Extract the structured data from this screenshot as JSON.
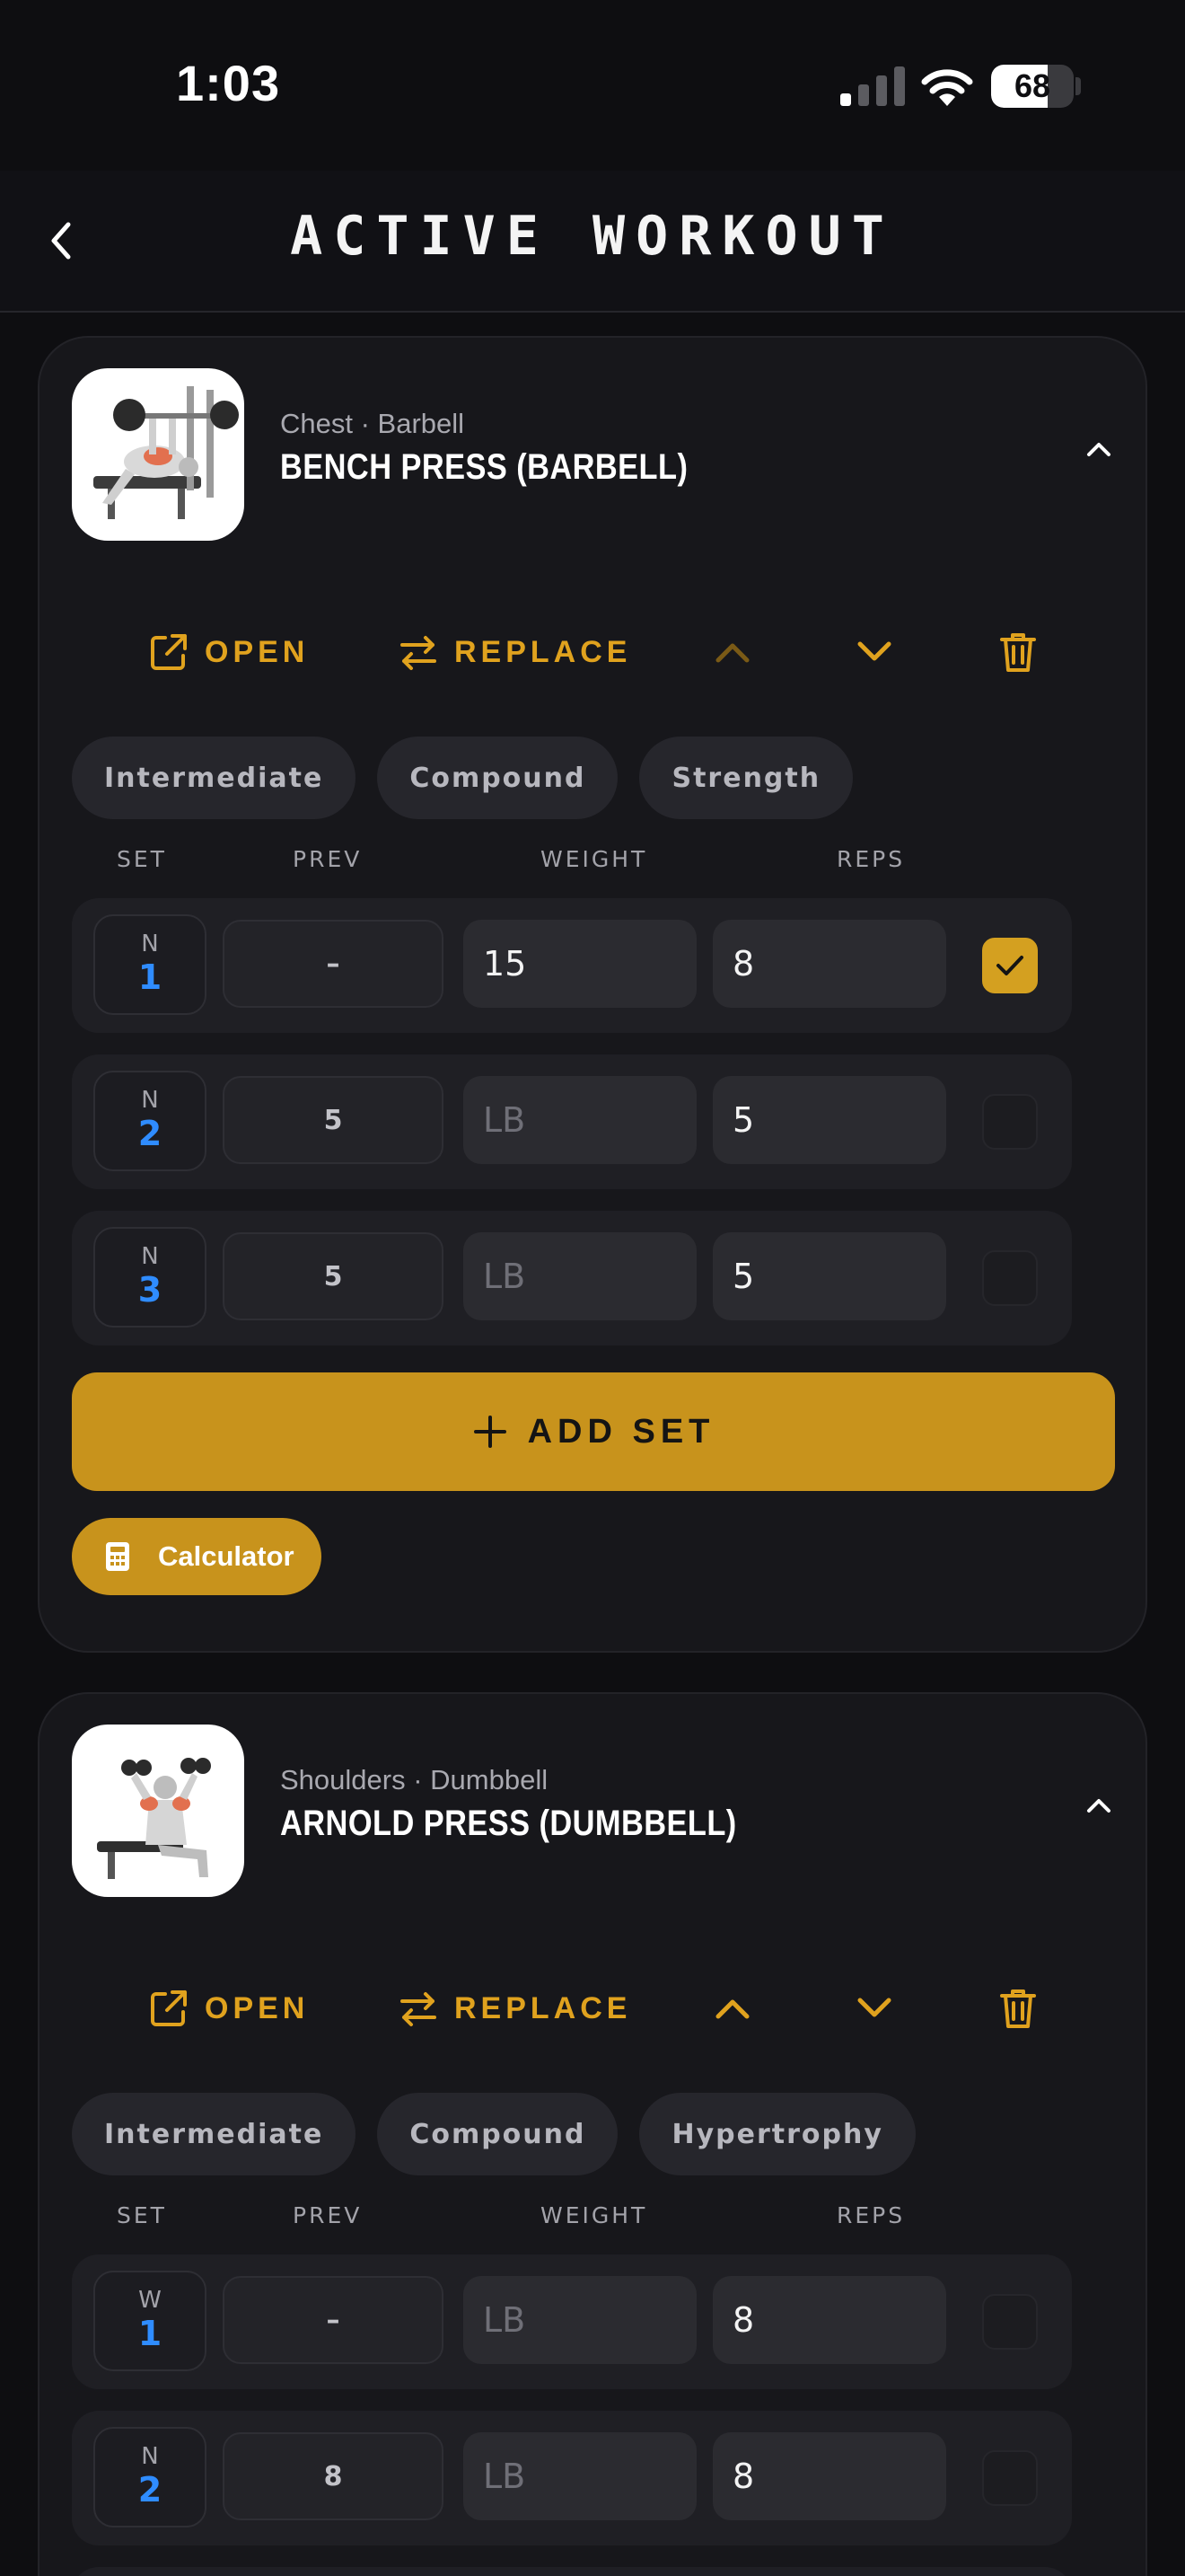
{
  "status_bar": {
    "time": "1:03",
    "battery": "68",
    "battery_level": 0.68
  },
  "header": {
    "title": "ACTIVE WORKOUT"
  },
  "columns": {
    "set": "SET",
    "prev": "PREV",
    "weight": "WEIGHT",
    "reps": "REPS"
  },
  "actions": {
    "open": "OPEN",
    "replace": "REPLACE"
  },
  "add_set_label": "ADD SET",
  "calculator_label": "Calculator",
  "exercises": [
    {
      "subtitle": "Chest · Barbell",
      "name": "BENCH PRESS (BARBELL)",
      "tags": [
        "Intermediate",
        "Compound",
        "Strength"
      ],
      "sets": [
        {
          "type": "N",
          "number": "1",
          "prev": "–",
          "weight": "15",
          "weight_placeholder": "LB",
          "reps": "8",
          "done": true
        },
        {
          "type": "N",
          "number": "2",
          "prev": "5",
          "weight": "",
          "weight_placeholder": "LB",
          "reps": "5",
          "done": false
        },
        {
          "type": "N",
          "number": "3",
          "prev": "5",
          "weight": "",
          "weight_placeholder": "LB",
          "reps": "5",
          "done": false
        }
      ]
    },
    {
      "subtitle": "Shoulders · Dumbbell",
      "name": "ARNOLD PRESS (DUMBBELL)",
      "tags": [
        "Intermediate",
        "Compound",
        "Hypertrophy"
      ],
      "sets": [
        {
          "type": "W",
          "number": "1",
          "prev": "–",
          "weight": "",
          "weight_placeholder": "LB",
          "reps": "8",
          "done": false
        },
        {
          "type": "N",
          "number": "2",
          "prev": "8",
          "weight": "",
          "weight_placeholder": "LB",
          "reps": "8",
          "done": false
        }
      ]
    }
  ],
  "colors": {
    "accent": "#E0A21E",
    "button": "#C8931C",
    "set_number": "#2F8CFF",
    "background": "#0E0E11",
    "card": "#17171B"
  }
}
